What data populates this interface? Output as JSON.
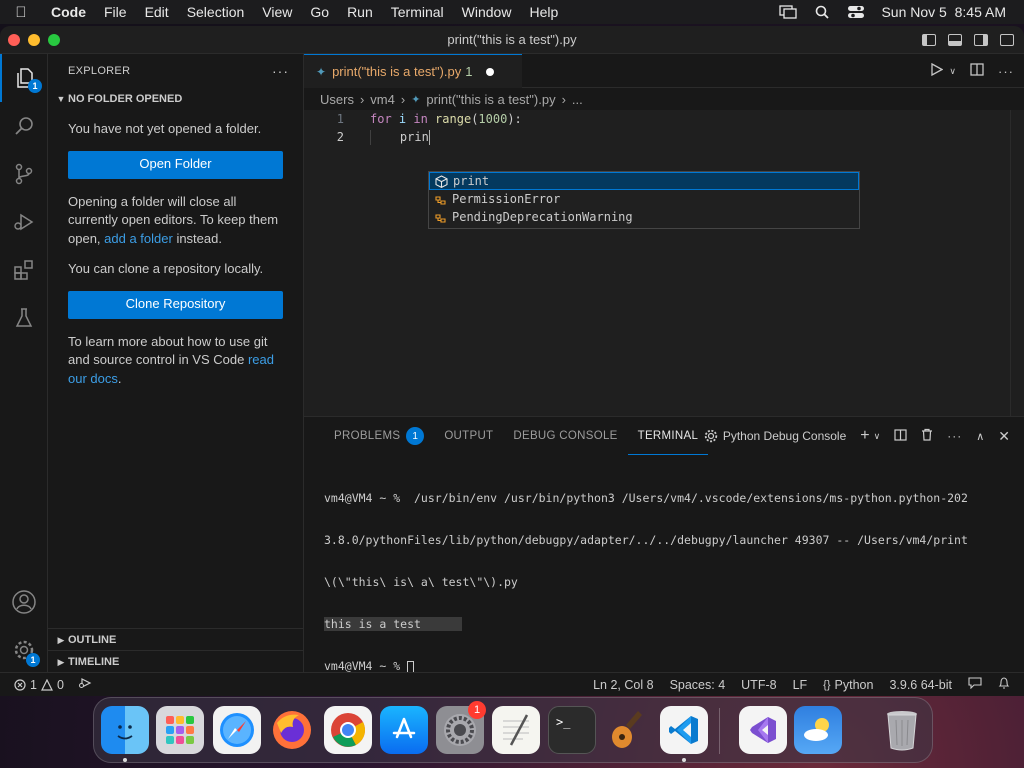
{
  "menubar": {
    "items": [
      "Code",
      "File",
      "Edit",
      "Selection",
      "View",
      "Go",
      "Run",
      "Terminal",
      "Window",
      "Help"
    ],
    "datetime": "Sun Nov 5  8:45 AM"
  },
  "window": {
    "title": "print(\"this is a test\").py"
  },
  "activity_bar": {
    "explorer_badge": "1",
    "manage_badge": "1"
  },
  "sidebar": {
    "header": "EXPLORER",
    "more": "···",
    "section_title": "NO FOLDER OPENED",
    "msg_no_folder": "You have not yet opened a folder.",
    "open_folder_label": "Open Folder",
    "msg_close_editors_pre": "Opening a folder will close all currently open editors. To keep them open, ",
    "add_folder_link": "add a folder",
    "msg_close_editors_post": " instead.",
    "msg_clone": "You can clone a repository locally.",
    "clone_repo_label": "Clone Repository",
    "msg_docs_pre": "To learn more about how to use git and source control in VS Code ",
    "read_docs_link": "read our docs",
    "msg_docs_post": ".",
    "outline_label": "OUTLINE",
    "timeline_label": "TIMELINE"
  },
  "editor": {
    "tab_label": "print(\"this is a test\").py",
    "tab_problem_count": "1",
    "breadcrumb": [
      "Users",
      "vm4",
      "print(\"this is a test\").py",
      "..."
    ],
    "lines": [
      {
        "num": "1",
        "kw1": "for",
        "v": " i ",
        "kw2": "in",
        "fn": " range",
        "p1": "(",
        "n": "1000",
        "p2": "):"
      },
      {
        "num": "2",
        "text": "    prin"
      }
    ],
    "suggestions": [
      {
        "pre": "",
        "hl": "print",
        "post": "",
        "label": "print"
      },
      {
        "label": "PermissionError"
      },
      {
        "label": "PendingDeprecationWarning"
      }
    ]
  },
  "panel": {
    "tabs": [
      "PROBLEMS",
      "OUTPUT",
      "DEBUG CONSOLE",
      "TERMINAL"
    ],
    "problems_badge": "1",
    "terminal_name": "Python Debug Console",
    "terminal_lines": [
      "vm4@VM4 ~ %  /usr/bin/env /usr/bin/python3 /Users/vm4/.vscode/extensions/ms-python.python-202",
      "3.8.0/pythonFiles/lib/python/debugpy/adapter/../../debugpy/launcher 49307 -- /Users/vm4/print",
      "\\(\\\"this\\ is\\ a\\ test\\\"\\).py"
    ],
    "output_line": "this is a test",
    "prompt_line": "vm4@VM4 ~ % "
  },
  "statusbar": {
    "errors": "1",
    "warnings": "0",
    "position": "Ln 2, Col 8",
    "spaces": "Spaces: 4",
    "encoding": "UTF-8",
    "eol": "LF",
    "language": "Python",
    "interpreter": "3.9.6 64-bit"
  },
  "dock": {
    "apps": [
      "Finder",
      "Launchpad",
      "Safari",
      "Firefox",
      "Chrome",
      "App Store",
      "System Settings",
      "TextEdit",
      "Terminal",
      "GarageBand",
      "VS Code",
      "Visual Studio",
      "Weather",
      "Trash"
    ],
    "settings_badge": "1"
  }
}
